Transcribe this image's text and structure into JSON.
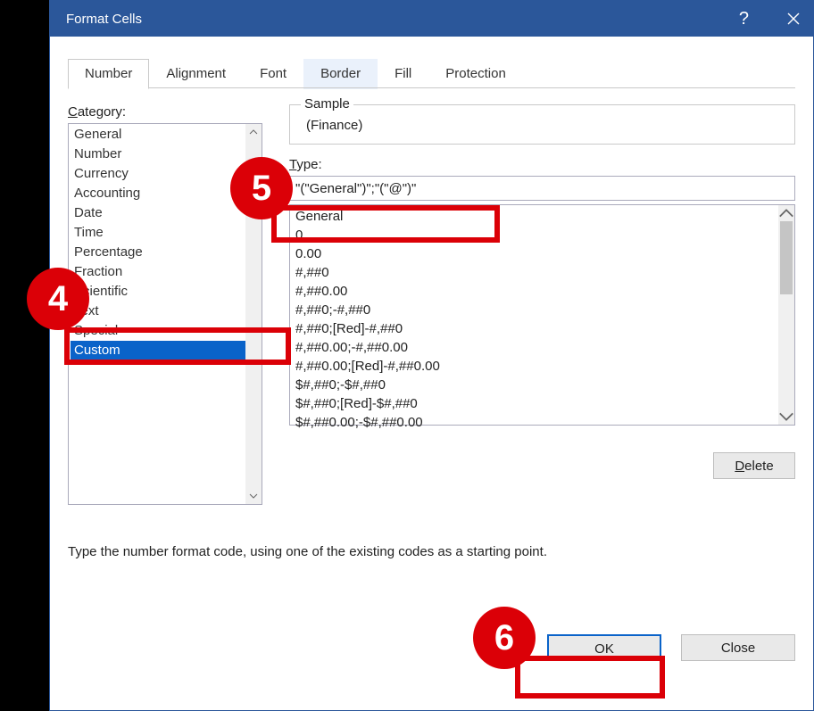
{
  "window": {
    "title": "Format Cells"
  },
  "tabs": {
    "items": [
      {
        "label": "Number"
      },
      {
        "label": "Alignment"
      },
      {
        "label": "Font"
      },
      {
        "label": "Border"
      },
      {
        "label": "Fill"
      },
      {
        "label": "Protection"
      }
    ],
    "active_index": 0,
    "hover_index": 3
  },
  "category": {
    "label": "Category:",
    "items": [
      "General",
      "Number",
      "Currency",
      "Accounting",
      "Date",
      "Time",
      "Percentage",
      "Fraction",
      "Scientific",
      "Text",
      "Special",
      "Custom"
    ],
    "selected_index": 11
  },
  "sample": {
    "label": "Sample",
    "value": "(Finance)"
  },
  "type": {
    "label": "Type:",
    "value": "\"(\"General\")\";\"(\"@\")\""
  },
  "format_codes": [
    "General",
    "0",
    "0.00",
    "#,##0",
    "#,##0.00",
    "#,##0;-#,##0",
    "#,##0;[Red]-#,##0",
    "#,##0.00;-#,##0.00",
    "#,##0.00;[Red]-#,##0.00",
    "$#,##0;-$#,##0",
    "$#,##0;[Red]-$#,##0",
    "$#,##0.00;-$#,##0.00"
  ],
  "buttons": {
    "delete": "Delete",
    "ok": "OK",
    "close": "Close"
  },
  "hint_text": "Type the number format code, using one of the existing codes as a starting point.",
  "annotations": {
    "step4": "4",
    "step5": "5",
    "step6": "6"
  }
}
